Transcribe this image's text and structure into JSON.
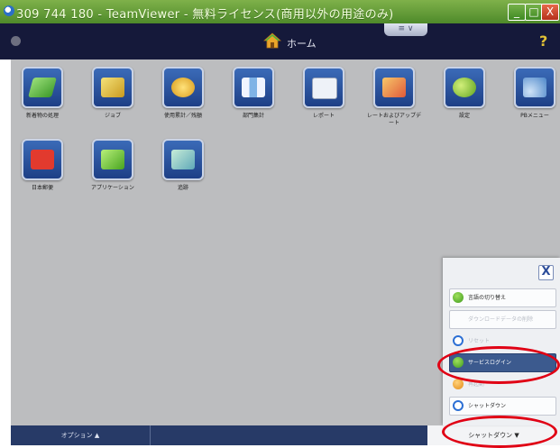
{
  "window": {
    "title": "309 744 180 - TeamViewer - 無料ライセンス(商用以外の用途のみ)",
    "min_label": "_",
    "max_label": "□",
    "close_label": "X"
  },
  "header": {
    "home_label": "ホーム",
    "help_label": "?",
    "tab_label": "≡ ∨"
  },
  "tiles": [
    {
      "label": "新着物の処理",
      "icon": "documents-icon",
      "color": "#6fcf4a"
    },
    {
      "label": "ジョブ",
      "icon": "folders-icon",
      "color": "#e8d05a"
    },
    {
      "label": "使用累計／残額",
      "icon": "coins-icon",
      "color": "#f0c23a"
    },
    {
      "label": "部門集計",
      "icon": "map-icon",
      "color": "#6fa7e8"
    },
    {
      "label": "レポート",
      "icon": "report-chart-icon",
      "color": "#e9eef5"
    },
    {
      "label": "レートおよびアップデート",
      "icon": "rate-update-icon",
      "color": "#f3a53b"
    },
    {
      "label": "設定",
      "icon": "gears-icon",
      "color": "#9ad24a"
    },
    {
      "label": "PBメニュー",
      "icon": "satellite-pb-icon",
      "color": "#7fb3e6"
    },
    {
      "label": "日本郵便",
      "icon": "japan-post-icon",
      "color": "#e23a2e"
    },
    {
      "label": "アプリケーション",
      "icon": "a-plus-icon",
      "color": "#7ed04a"
    },
    {
      "label": "追跡",
      "icon": "tracking-map-icon",
      "color": "#8fd0c8"
    }
  ],
  "popup": {
    "close_label": "X",
    "items": [
      {
        "label": "言語の切り替え",
        "icon": "language-switch-icon",
        "state": "normal"
      },
      {
        "label": "ダウンロードデータの削除",
        "icon": "none",
        "state": "disabled"
      },
      {
        "label": "リセット",
        "icon": "power-icon",
        "state": "disabled"
      },
      {
        "label": "サービスログイン",
        "icon": "service-login-icon",
        "state": "selected"
      },
      {
        "label": "再起動",
        "icon": "restart-icon",
        "state": "disabled"
      },
      {
        "label": "シャットダウン",
        "icon": "shutdown-icon",
        "state": "normal"
      }
    ]
  },
  "bottombar": {
    "options_label": "オプション ▲",
    "shutdown_label": "シャットダウン ▼"
  },
  "colors": {
    "titlebar": "#5e9a35",
    "appbar": "#15193a",
    "workspace": "#bcbdbf",
    "bottombar": "#273a67",
    "annotation": "#e00014"
  }
}
